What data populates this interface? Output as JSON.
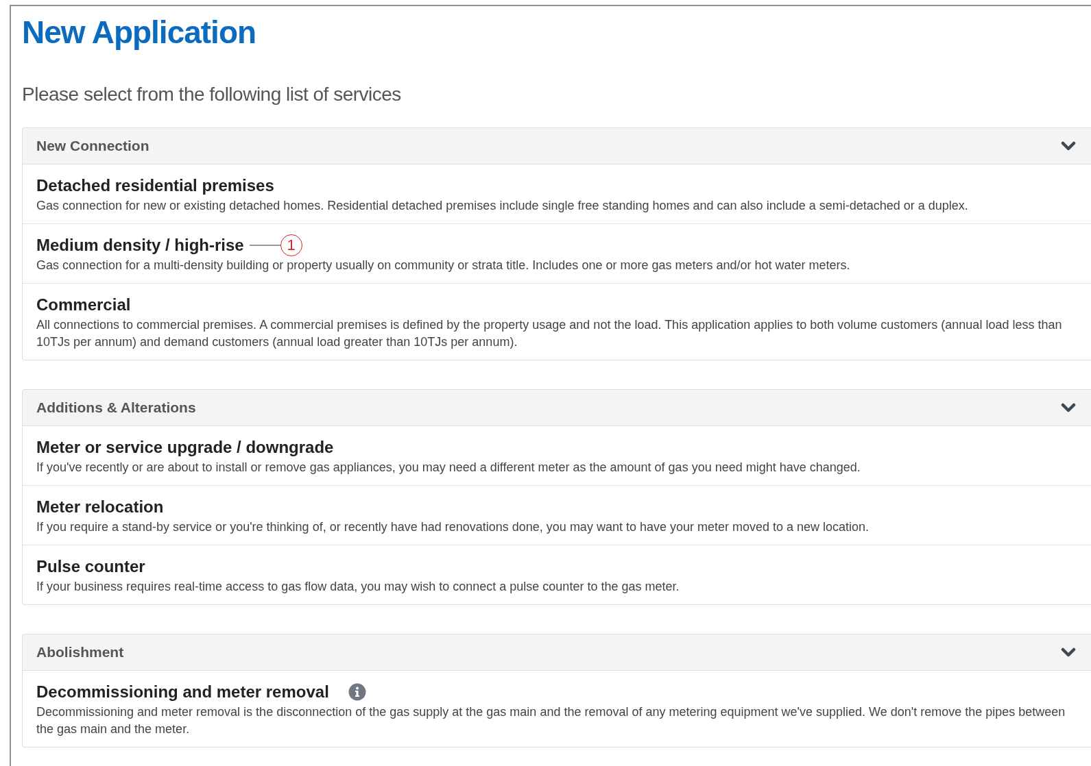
{
  "title": "New Application",
  "subtitle": "Please select from the following list of services",
  "sections": [
    {
      "heading": "New Connection",
      "expanded": true,
      "items": [
        {
          "title": "Detached residential premises",
          "description": "Gas connection for new or existing detached homes. Residential detached premises include single free standing homes and can also include a semi-detached or a duplex."
        },
        {
          "title": "Medium density / high-rise",
          "description": "Gas connection for a multi-density building or property usually on community or strata title. Includes one or more gas meters and/or hot water meters.",
          "callout": "1"
        },
        {
          "title": "Commercial",
          "description": "All connections to commercial premises. A commercial premises is defined by the property usage and not the load. This application applies to both volume customers (annual load less than 10TJs per annum) and demand customers (annual load greater than 10TJs per annum)."
        }
      ]
    },
    {
      "heading": "Additions & Alterations",
      "expanded": true,
      "items": [
        {
          "title": "Meter or service upgrade / downgrade",
          "description": "If you've recently or are about to install or remove gas appliances, you may need a different meter as the amount of gas you need might have changed."
        },
        {
          "title": "Meter relocation",
          "description": "If you require a stand-by service or you're thinking of, or recently have had renovations done, you may want to have your meter moved to a new location."
        },
        {
          "title": "Pulse counter",
          "description": "If your business requires real-time access to gas flow data, you may wish to connect a pulse counter to the gas meter."
        }
      ]
    },
    {
      "heading": "Abolishment",
      "expanded": true,
      "items": [
        {
          "title": "Decommissioning and meter removal",
          "description": "Decommissioning and meter removal is the disconnection of the gas supply at the gas main and the removal of any metering equipment we've supplied. We don't remove the pipes between the gas main and the meter.",
          "info": true
        }
      ]
    }
  ]
}
